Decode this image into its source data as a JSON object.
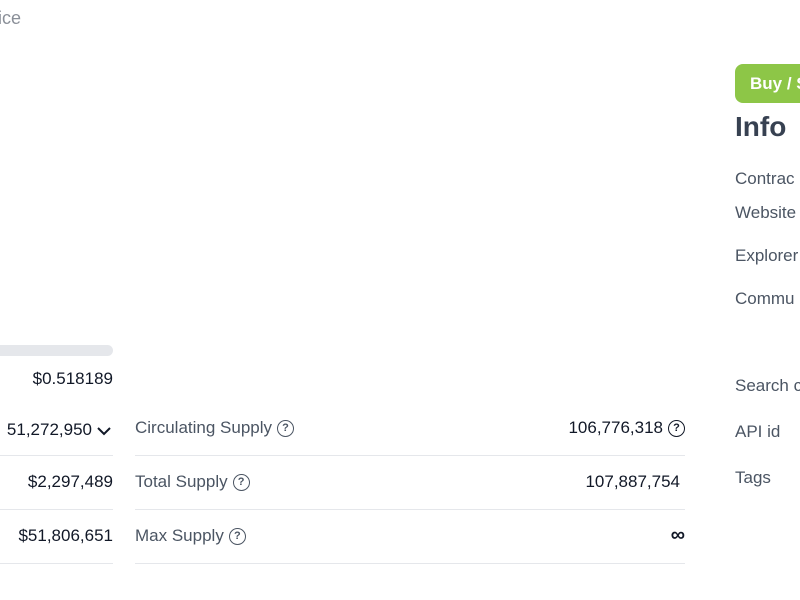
{
  "header": {
    "title": "ice"
  },
  "left": {
    "price": "$0.518189",
    "market_cap": "51,272,950",
    "volume": "$2,297,489",
    "fdv": "$51,806,651"
  },
  "supply": [
    {
      "label": "Circulating Supply",
      "value": "106,776,318",
      "value_help": true
    },
    {
      "label": "Total Supply",
      "value": "107,887,754",
      "value_help": false
    },
    {
      "label": "Max Supply",
      "value": "∞",
      "value_help": false
    }
  ],
  "sidebar": {
    "buy_button": "Buy / S",
    "info_title": "Info",
    "labels": [
      "Contrac",
      "Website",
      "Explorer",
      "Commu",
      "Search c",
      "API id",
      "Tags"
    ]
  },
  "colors": {
    "accent": "#8dc647"
  },
  "icons": {
    "help": "question-circle-icon",
    "expand": "chevron-down-icon"
  }
}
